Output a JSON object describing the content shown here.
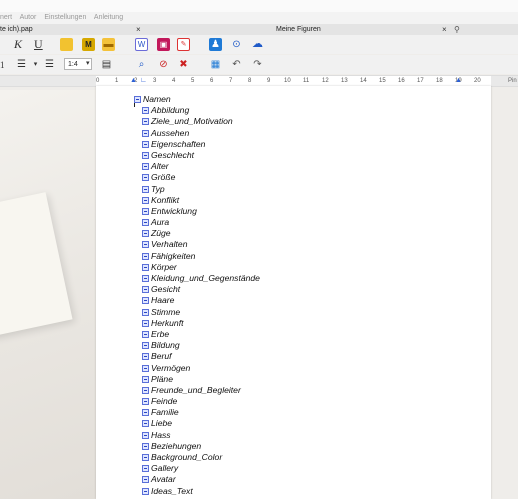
{
  "menubar": {
    "items": [
      "nert",
      "Autor",
      "Einstellungen",
      "Anleitung"
    ]
  },
  "tabs": [
    {
      "label": "te ich).pap",
      "close": "×"
    },
    {
      "label": "Meine Figuren",
      "close": "×"
    }
  ],
  "tab_extra_icon": "pin-icon",
  "toolbar": {
    "italic_label": "K",
    "underline_label": "U",
    "list_style_value": "1",
    "zoom_value": "1:4",
    "row1_icons": [
      "folder-icon",
      "marker-icon",
      "comment-icon",
      "word-export-icon",
      "image-icon",
      "pdf-icon",
      "figure-icon",
      "search-user-icon",
      "chat-icon"
    ],
    "row2_icons": [
      "list-icon",
      "align-icon",
      "ruler-icon",
      "find-icon",
      "block-icon",
      "delete-icon",
      "format-icon",
      "undo-icon",
      "redo-icon"
    ]
  },
  "ruler": {
    "ticks": [
      "0",
      "1",
      "2",
      "3",
      "4",
      "5",
      "6",
      "7",
      "8",
      "9",
      "10",
      "11",
      "12",
      "13",
      "14",
      "15",
      "16",
      "17",
      "18",
      "19",
      "20"
    ],
    "side_label": "Pin"
  },
  "outline": {
    "root": "Namen",
    "children": [
      "Abbildung",
      "Ziele_und_Motivation",
      "Aussehen",
      "Eigenschaften",
      "Geschlecht",
      "Alter",
      "Größe",
      "Typ",
      "Konflikt",
      "Entwicklung",
      "Aura",
      "Züge",
      "Verhalten",
      "Fähigkeiten",
      "Körper",
      "Kleidung_und_Gegenstände",
      "Gesicht",
      "Haare",
      "Stimme",
      "Herkunft",
      "Erbe",
      "Bildung",
      "Beruf",
      "Vermögen",
      "Pläne",
      "Freunde_und_Begleiter",
      "Feinde",
      "Familie",
      "Liebe",
      "Hass",
      "Beziehungen",
      "Background_Color",
      "Gallery",
      "Avatar",
      "Ideas_Text"
    ]
  }
}
